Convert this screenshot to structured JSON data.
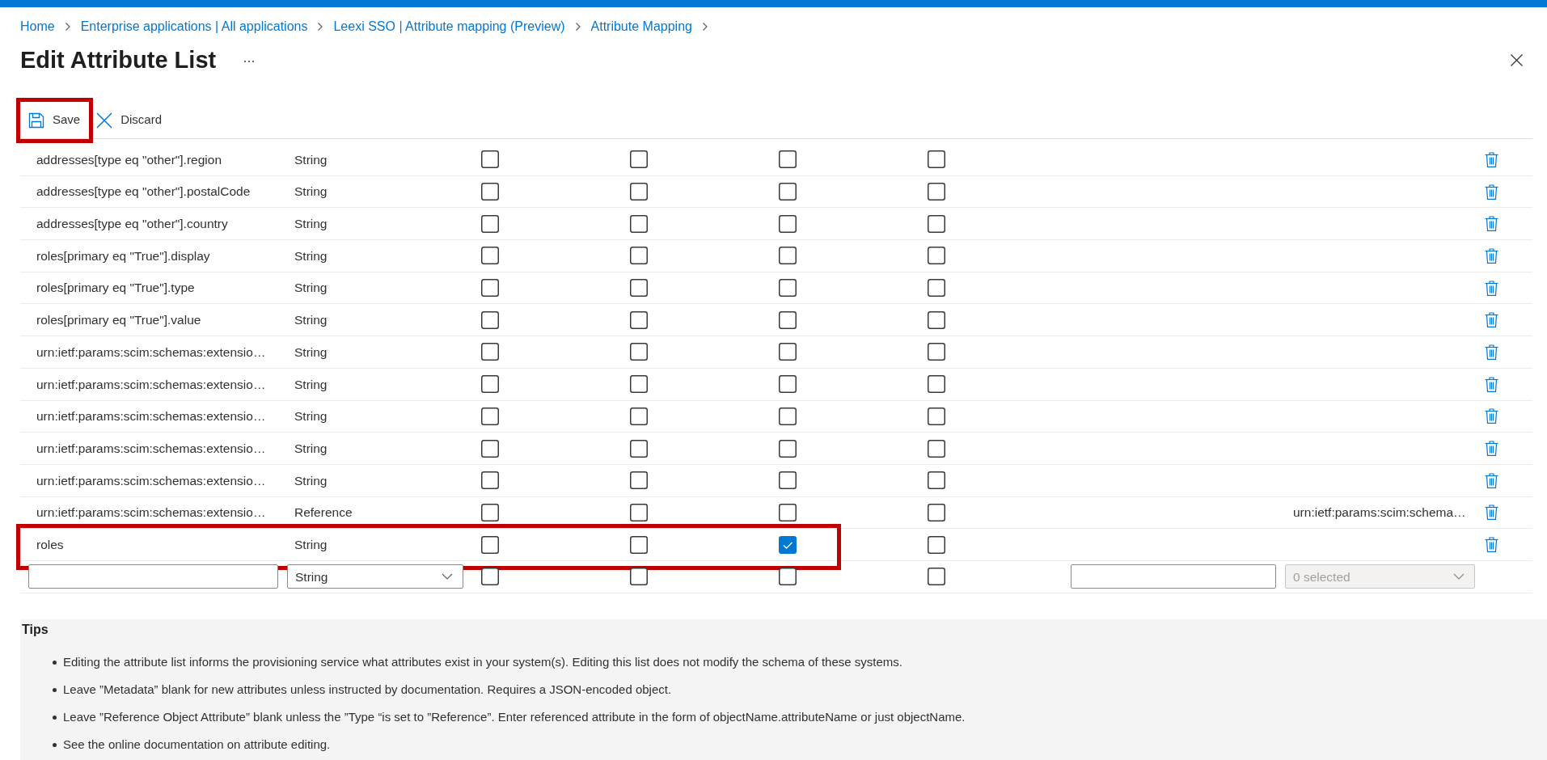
{
  "breadcrumb": [
    "Home",
    "Enterprise applications | All applications",
    "Leexi SSO | Attribute mapping (Preview)",
    "Attribute Mapping"
  ],
  "title": "Edit Attribute List",
  "toolbar": [
    {
      "kind": "save",
      "label": "Save",
      "highlighted": true
    },
    {
      "kind": "discard",
      "label": "Discard",
      "highlighted": false
    }
  ],
  "table": {
    "rows": [
      {
        "name": "addresses[type eq \"other\"].region",
        "type": "String",
        "checkboxes": [
          {
            "checked": false
          },
          {
            "checked": false
          },
          {
            "checked": false
          },
          {
            "checked": false
          }
        ],
        "highlighted": false
      },
      {
        "name": "addresses[type eq \"other\"].postalCode",
        "type": "String",
        "checkboxes": [
          {
            "checked": false
          },
          {
            "checked": false
          },
          {
            "checked": false
          },
          {
            "checked": false
          }
        ],
        "highlighted": false
      },
      {
        "name": "addresses[type eq \"other\"].country",
        "type": "String",
        "checkboxes": [
          {
            "checked": false
          },
          {
            "checked": false
          },
          {
            "checked": false
          },
          {
            "checked": false
          }
        ],
        "highlighted": false
      },
      {
        "name": "roles[primary eq \"True\"].display",
        "type": "String",
        "checkboxes": [
          {
            "checked": false
          },
          {
            "checked": false
          },
          {
            "checked": false
          },
          {
            "checked": false
          }
        ],
        "highlighted": false
      },
      {
        "name": "roles[primary eq \"True\"].type",
        "type": "String",
        "checkboxes": [
          {
            "checked": false
          },
          {
            "checked": false
          },
          {
            "checked": false
          },
          {
            "checked": false
          }
        ],
        "highlighted": false
      },
      {
        "name": "roles[primary eq \"True\"].value",
        "type": "String",
        "checkboxes": [
          {
            "checked": false
          },
          {
            "checked": false
          },
          {
            "checked": false
          },
          {
            "checked": false
          }
        ],
        "highlighted": false
      },
      {
        "name": "urn:ietf:params:scim:schemas:extensio…",
        "type": "String",
        "checkboxes": [
          {
            "checked": false
          },
          {
            "checked": false
          },
          {
            "checked": false
          },
          {
            "checked": false
          }
        ],
        "highlighted": false
      },
      {
        "name": "urn:ietf:params:scim:schemas:extensio…",
        "type": "String",
        "checkboxes": [
          {
            "checked": false
          },
          {
            "checked": false
          },
          {
            "checked": false
          },
          {
            "checked": false
          }
        ],
        "highlighted": false
      },
      {
        "name": "urn:ietf:params:scim:schemas:extensio…",
        "type": "String",
        "checkboxes": [
          {
            "checked": false
          },
          {
            "checked": false
          },
          {
            "checked": false
          },
          {
            "checked": false
          }
        ],
        "highlighted": false
      },
      {
        "name": "urn:ietf:params:scim:schemas:extensio…",
        "type": "String",
        "checkboxes": [
          {
            "checked": false
          },
          {
            "checked": false
          },
          {
            "checked": false
          },
          {
            "checked": false
          }
        ],
        "highlighted": false
      },
      {
        "name": "urn:ietf:params:scim:schemas:extensio…",
        "type": "String",
        "checkboxes": [
          {
            "checked": false
          },
          {
            "checked": false
          },
          {
            "checked": false
          },
          {
            "checked": false
          }
        ],
        "highlighted": false
      },
      {
        "name": "urn:ietf:params:scim:schemas:extensio…",
        "type": "Reference",
        "checkboxes": [
          {
            "checked": false
          },
          {
            "checked": false
          },
          {
            "checked": false
          },
          {
            "checked": false
          }
        ],
        "column_8": "urn:ietf:params:scim:schema…",
        "highlighted": false
      },
      {
        "name": "roles",
        "type": "String",
        "checkboxes": [
          {
            "checked": false
          },
          {
            "checked": false
          },
          {
            "checked": true
          },
          {
            "checked": false
          }
        ],
        "highlighted": true
      }
    ],
    "new_row": {
      "type": "String",
      "checkboxes": [
        {
          "checked": false
        },
        {
          "checked": false
        },
        {
          "checked": false
        },
        {
          "checked": false
        }
      ],
      "column_8": {
        "value": "0 selected",
        "disabled": true
      }
    }
  },
  "tips": {
    "title": "Tips",
    "items": [
      "Editing the attribute list informs the provisioning service what attributes exist in your system(s). Editing this list does not modify the schema of these systems.",
      "Leave ”Metadata” blank for new attributes unless instructed by documentation. Requires a JSON-encoded object.",
      "Leave ”Reference Object Attribute” blank unless the ”Type “is set to ”Reference”. Enter referenced attribute in the form of objectName.attributeName or just objectName.",
      "See the online documentation on attribute editing."
    ]
  }
}
